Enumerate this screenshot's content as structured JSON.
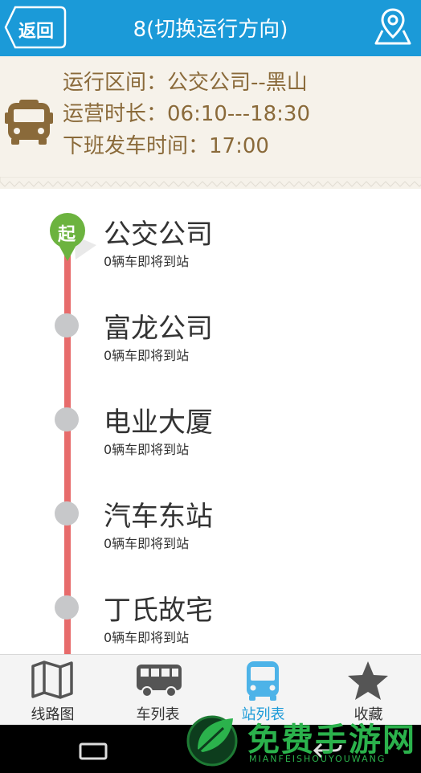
{
  "header": {
    "back_label": "返回",
    "title": "8(切换运行方向)",
    "map_icon": "map-pin-icon"
  },
  "info": {
    "bus_icon": "bus-front-icon",
    "route_range": "运行区间：公交公司--黑山",
    "operating_hours": "运营时长：06:10---18:30",
    "last_departure": "下班发车时间：17:00"
  },
  "stations": [
    {
      "name": "公交公司",
      "status": "0辆车即将到站"
    },
    {
      "name": "富龙公司",
      "status": "0辆车即将到站"
    },
    {
      "name": "电业大厦",
      "status": "0辆车即将到站"
    },
    {
      "name": "汽车东站",
      "status": "0辆车即将到站"
    },
    {
      "name": "丁氏故宅",
      "status": "0辆车即将到站"
    }
  ],
  "start_marker": "起",
  "tabs": [
    {
      "label": "线路图",
      "icon": "map-icon",
      "active": false
    },
    {
      "label": "车列表",
      "icon": "bus-side-icon",
      "active": false
    },
    {
      "label": "站列表",
      "icon": "bus-front-icon",
      "active": true
    },
    {
      "label": "收藏",
      "icon": "star-icon",
      "active": false
    }
  ],
  "watermark": {
    "title": "免费手游网",
    "subtitle": "MIANFEISHOUYOUWANG"
  },
  "colors": {
    "header": "#1b9ad8",
    "info_bg": "#f6f2ea",
    "info_text": "#8a6a3a",
    "route_line": "#e76b6b",
    "start_marker": "#6cb33f",
    "active_tab": "#1b9ad8"
  }
}
